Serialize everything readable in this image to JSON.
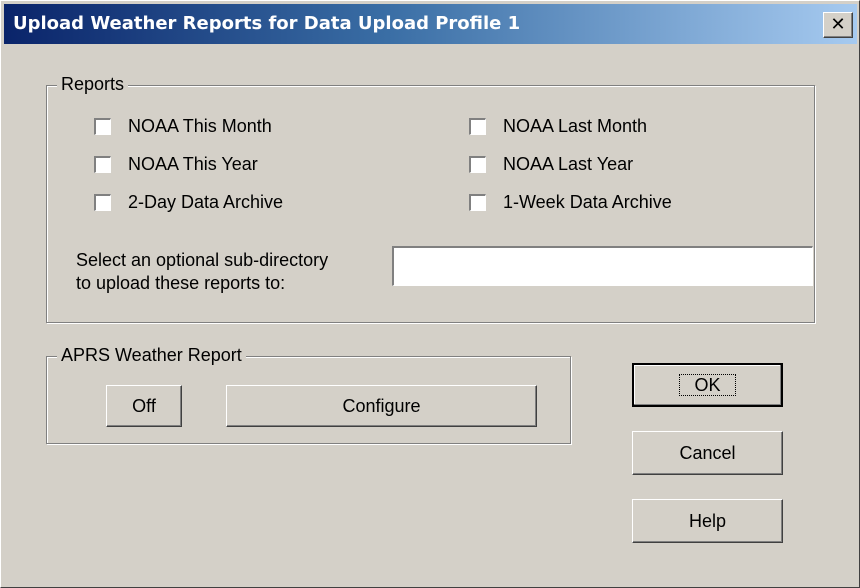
{
  "dialog": {
    "title": "Upload Weather Reports for Data Upload Profile 1",
    "close_glyph": "✕"
  },
  "reports": {
    "group_label": "Reports",
    "checkboxes": [
      {
        "label": "NOAA This Month",
        "checked": false
      },
      {
        "label": "NOAA Last Month",
        "checked": false
      },
      {
        "label": "NOAA This Year",
        "checked": false
      },
      {
        "label": "NOAA Last Year",
        "checked": false
      },
      {
        "label": "2-Day Data Archive",
        "checked": false
      },
      {
        "label": "1-Week Data Archive",
        "checked": false
      }
    ],
    "subdir_label_line1": "Select an optional sub-directory",
    "subdir_label_line2": "to upload these reports to:",
    "subdir_value": ""
  },
  "aprs": {
    "group_label": "APRS Weather Report",
    "off_label": "Off",
    "configure_label": "Configure"
  },
  "buttons": {
    "ok_label": "OK",
    "cancel_label": "Cancel",
    "help_label": "Help"
  }
}
